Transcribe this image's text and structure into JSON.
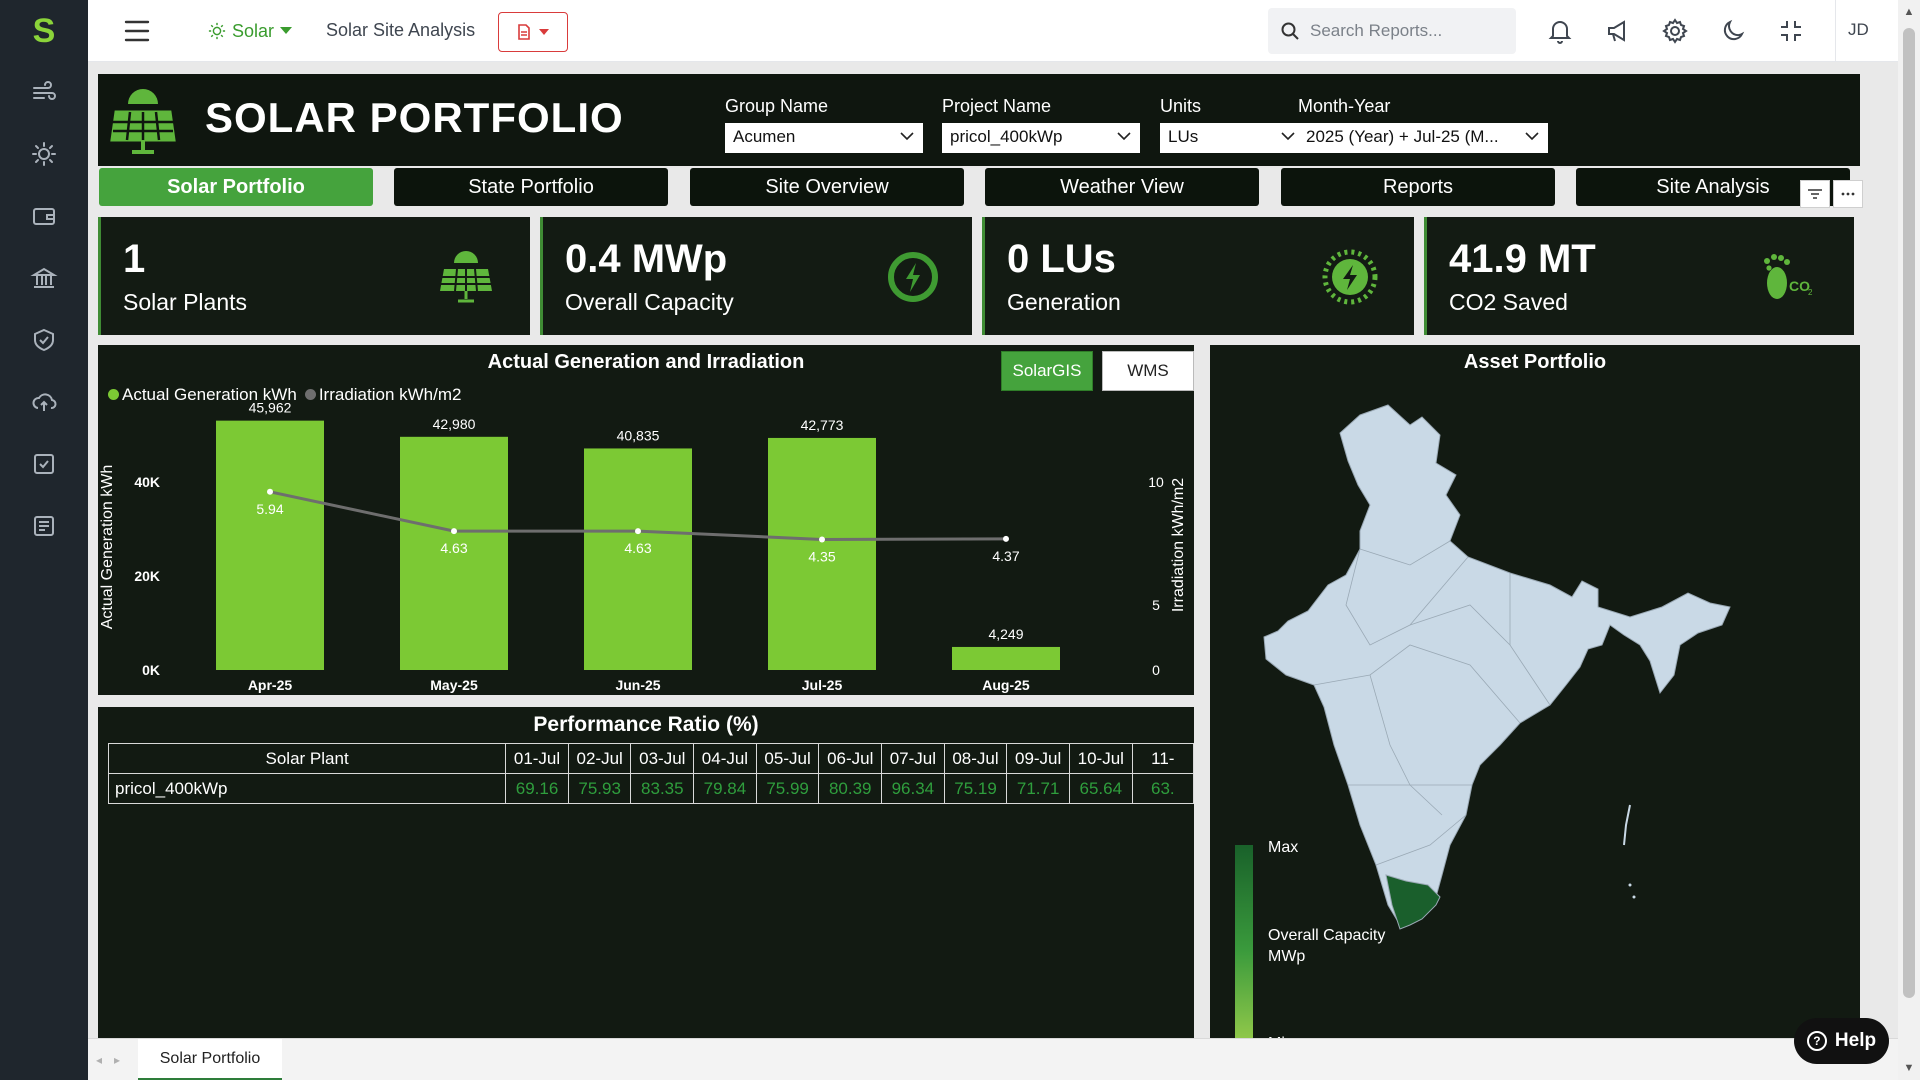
{
  "app": {
    "logo_letter": "S",
    "module_label": "Solar",
    "breadcrumb": "Solar Site Analysis",
    "search_placeholder": "Search Reports...",
    "user_initials": "JD",
    "help_label": "Help"
  },
  "rail": {
    "icons": [
      "wind-icon",
      "sun-icon",
      "wallet-icon",
      "bank-icon",
      "shield-check-icon",
      "cloud-upload-icon",
      "checkbox-icon",
      "report-list-icon"
    ]
  },
  "header": {
    "title": "SOLAR PORTFOLIO",
    "filters": [
      {
        "label": "Group Name",
        "value": "Acumen"
      },
      {
        "label": "Project Name",
        "value": "pricol_400kWp"
      },
      {
        "label": "Units",
        "value": "LUs"
      },
      {
        "label": "Month-Year",
        "value": "2025 (Year) + Jul-25 (M..."
      }
    ]
  },
  "tabs": [
    {
      "label": "Solar Portfolio",
      "active": true
    },
    {
      "label": "State Portfolio",
      "active": false
    },
    {
      "label": "Site Overview",
      "active": false
    },
    {
      "label": "Weather View",
      "active": false
    },
    {
      "label": "Reports",
      "active": false
    },
    {
      "label": "Site Analysis",
      "active": false
    }
  ],
  "kpis": [
    {
      "value": "1",
      "label": "Solar Plants",
      "icon": "solar-panel-icon"
    },
    {
      "value": "0.4 MWp",
      "label": "Overall Capacity",
      "icon": "power-bolt-icon"
    },
    {
      "value": "0 LUs",
      "label": "Generation",
      "icon": "gear-bolt-icon"
    },
    {
      "value": "41.9 MT",
      "label": "CO2 Saved",
      "icon": "co2-footprint-icon"
    }
  ],
  "generation_chart": {
    "title": "Actual Generation and Irradiation",
    "legend": [
      "Actual Generation kWh",
      "Irradiation kWh/m2"
    ],
    "y_left_label": "Actual Generation kWh",
    "y_right_label": "Irradiation kWh/m2",
    "y_left_ticks": [
      "0K",
      "20K",
      "40K"
    ],
    "y_right_ticks": [
      "0",
      "5",
      "10"
    ],
    "source_buttons": [
      "SolarGIS",
      "WMS"
    ]
  },
  "chart_data": {
    "type": "bar",
    "categories": [
      "Apr-25",
      "May-25",
      "Jun-25",
      "Jul-25",
      "Aug-25"
    ],
    "series": [
      {
        "name": "Actual Generation kWh",
        "type": "bar",
        "values": [
          45962,
          42980,
          40835,
          42773,
          4249
        ],
        "labels": [
          "45,962",
          "42,980",
          "40,835",
          "42,773",
          "4,249"
        ],
        "color": "#7cc934",
        "axis": "left",
        "ylim": [
          0,
          47000
        ]
      },
      {
        "name": "Irradiation kWh/m2",
        "type": "line",
        "values": [
          5.94,
          4.63,
          4.63,
          4.35,
          4.37
        ],
        "labels": [
          "5.94",
          "4.63",
          "4.63",
          "4.35",
          "4.37"
        ],
        "color": "#6e6e6e",
        "axis": "right",
        "ylim": [
          0,
          10
        ]
      }
    ]
  },
  "performance": {
    "title": "Performance Ratio (%)",
    "plant_header": "Solar Plant",
    "date_headers": [
      "01-Jul",
      "02-Jul",
      "03-Jul",
      "04-Jul",
      "05-Jul",
      "06-Jul",
      "07-Jul",
      "08-Jul",
      "09-Jul",
      "10-Jul",
      "11-"
    ],
    "rows": [
      {
        "plant": "pricol_400kWp",
        "values": [
          "69.16",
          "75.93",
          "83.35",
          "79.84",
          "75.99",
          "80.39",
          "96.34",
          "75.19",
          "71.71",
          "65.64",
          "63."
        ]
      }
    ]
  },
  "asset": {
    "title": "Asset Portfolio",
    "scale_max": "Max",
    "scale_label": "Overall Capacity MWp",
    "scale_min": "Min"
  },
  "bottom_tabs": {
    "active": "Solar Portfolio"
  },
  "colors": {
    "accent": "#45a33d",
    "bar": "#7cc934",
    "panel": "#121a12",
    "rail": "#1f262d"
  }
}
